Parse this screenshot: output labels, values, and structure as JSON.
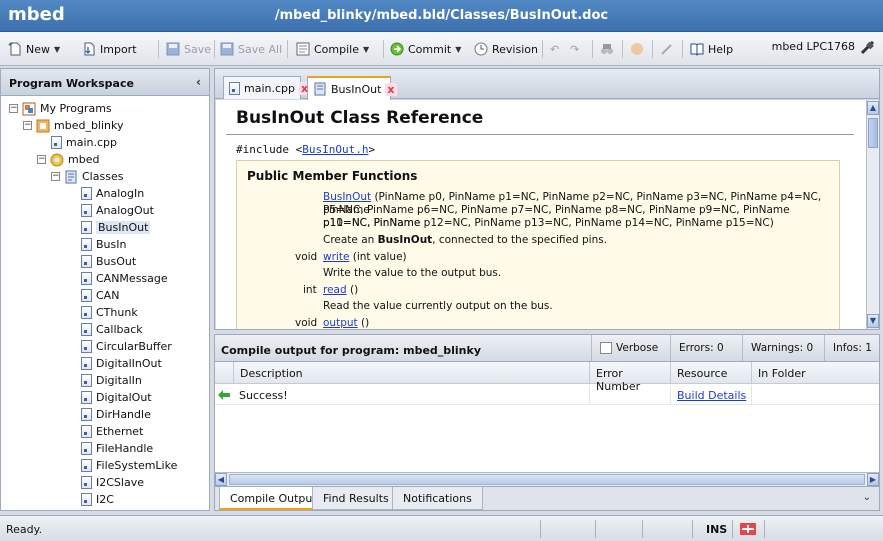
{
  "title": {
    "logo": "mbed",
    "path": "/mbed_blinky/mbed.bld/Classes/BusInOut.doc"
  },
  "toolbar": {
    "new": "New",
    "import": "Import",
    "save": "Save",
    "save_all": "Save All",
    "compile": "Compile",
    "commit": "Commit",
    "revision": "Revision",
    "help": "Help",
    "board": "mbed LPC1768"
  },
  "workspace": {
    "title": "Program Workspace",
    "tree": {
      "root": "My Programs",
      "program": "mbed_blinky",
      "main": "main.cpp",
      "lib": "mbed",
      "classes": "Classes",
      "items": [
        "AnalogIn",
        "AnalogOut",
        "BusInOut",
        "BusIn",
        "BusOut",
        "CANMessage",
        "CAN",
        "CThunk",
        "Callback",
        "CircularBuffer",
        "DigitalInOut",
        "DigitalIn",
        "DigitalOut",
        "DirHandle",
        "Ethernet",
        "FileHandle",
        "FileSystemLike",
        "I2CSlave",
        "I2C"
      ]
    }
  },
  "editor_tabs": [
    {
      "label": "main.cpp"
    },
    {
      "label": "BusInOut"
    }
  ],
  "doc": {
    "title": "BusInOut Class Reference",
    "include_prefix": "#include <",
    "include_file": "BusInOut.h",
    "include_suffix": ">",
    "pmf_title": "Public Member Functions",
    "ctor_name": "BusInOut",
    "ctor_l1": " (PinName p0, PinName p1=NC, PinName p2=NC, PinName p3=NC, PinName p4=NC, PinName",
    "ctor_l2": "p5=NC, PinName p6=NC, PinName p7=NC, PinName p8=NC, PinName p9=NC, PinName p10=NC, PinName",
    "ctor_l3": "p11=NC, PinName p12=NC, PinName p13=NC, PinName p14=NC, PinName p15=NC)",
    "ctor_desc_a": "Create an ",
    "ctor_desc_b": "BusInOut",
    "ctor_desc_c": ", connected to the specified pins.",
    "write_type": "void",
    "write_name": "write",
    "write_args": " (int value)",
    "write_desc": "Write the value to the output bus.",
    "read_type": "int",
    "read_name": "read",
    "read_args": " ()",
    "read_desc": "Read the value currently output on the bus.",
    "output_type": "void",
    "output_name": "output",
    "output_args": " ()"
  },
  "compile": {
    "title": "Compile output for program: mbed_blinky",
    "verbose": "Verbose",
    "errors": "Errors: 0",
    "warnings": "Warnings: 0",
    "infos": "Infos: 1",
    "columns": [
      "Description",
      "Error Number",
      "Resource",
      "In Folder"
    ],
    "row": {
      "description": "Success!",
      "error_number": "",
      "resource": "Build Details",
      "folder": ""
    }
  },
  "bottom_tabs": [
    "Compile Output",
    "Find Results",
    "Notifications"
  ],
  "status": {
    "text": "Ready.",
    "ins": "INS"
  },
  "colors": {
    "titlebar": "#3c6fae",
    "accent": "#f0a020",
    "link": "#1a3ccf"
  }
}
